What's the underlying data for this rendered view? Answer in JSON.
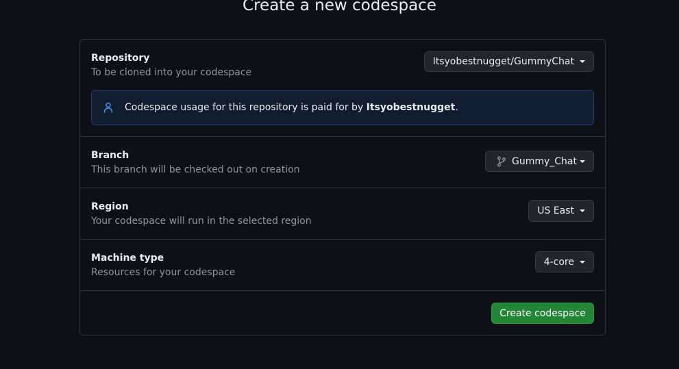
{
  "page": {
    "title": "Create a new codespace"
  },
  "repository": {
    "title": "Repository",
    "description": "To be cloned into your codespace",
    "selected": "Itsyobestnugget/GummyChat",
    "notice_prefix": "Codespace usage for this repository is paid for by ",
    "notice_owner": "Itsyobestnugget",
    "notice_suffix": ".",
    "notice_icon": "person-icon"
  },
  "branch": {
    "title": "Branch",
    "description": "This branch will be checked out on creation",
    "selected": "Gummy_Chat",
    "icon": "git-branch-icon"
  },
  "region": {
    "title": "Region",
    "description": "Your codespace will run in the selected region",
    "selected": "US East"
  },
  "machine": {
    "title": "Machine type",
    "description": "Resources for your codespace",
    "selected": "4-core"
  },
  "actions": {
    "create_label": "Create codespace"
  },
  "colors": {
    "background": "#0d1117",
    "border": "#30363d",
    "primary_button": "#238636",
    "notice_bg": "#121d2f",
    "notice_border": "#1f4270",
    "accent_icon": "#4493f8"
  }
}
